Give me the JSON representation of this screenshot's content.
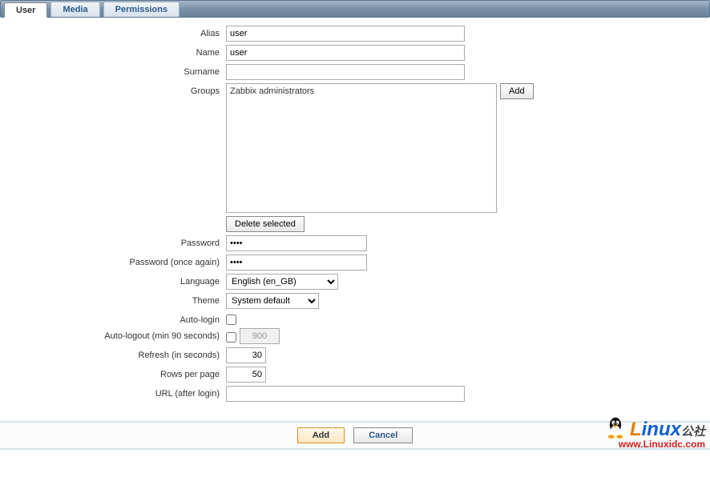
{
  "tabs": {
    "user": "User",
    "media": "Media",
    "permissions": "Permissions"
  },
  "labels": {
    "alias": "Alias",
    "name": "Name",
    "surname": "Surname",
    "groups": "Groups",
    "password": "Password",
    "password_again": "Password (once again)",
    "language": "Language",
    "theme": "Theme",
    "auto_login": "Auto-login",
    "auto_logout": "Auto-logout (min 90 seconds)",
    "refresh": "Refresh (in seconds)",
    "rows_per_page": "Rows per page",
    "url_after_login": "URL (after login)"
  },
  "values": {
    "alias": "user",
    "name": "user",
    "surname": "",
    "groups_list": [
      "Zabbix administrators"
    ],
    "password": "••••",
    "password_again": "••••",
    "language": "English (en_GB)",
    "theme": "System default",
    "auto_login": false,
    "auto_logout_enabled": false,
    "auto_logout_value": "900",
    "refresh": "30",
    "rows_per_page": "50",
    "url_after_login": ""
  },
  "buttons": {
    "add_group": "Add",
    "delete_selected": "Delete selected",
    "add": "Add",
    "cancel": "Cancel"
  },
  "watermark": {
    "brand_left": "L",
    "brand_mid": "inux",
    "brand_suffix": "公社",
    "url": "www.Linuxidc.com"
  }
}
